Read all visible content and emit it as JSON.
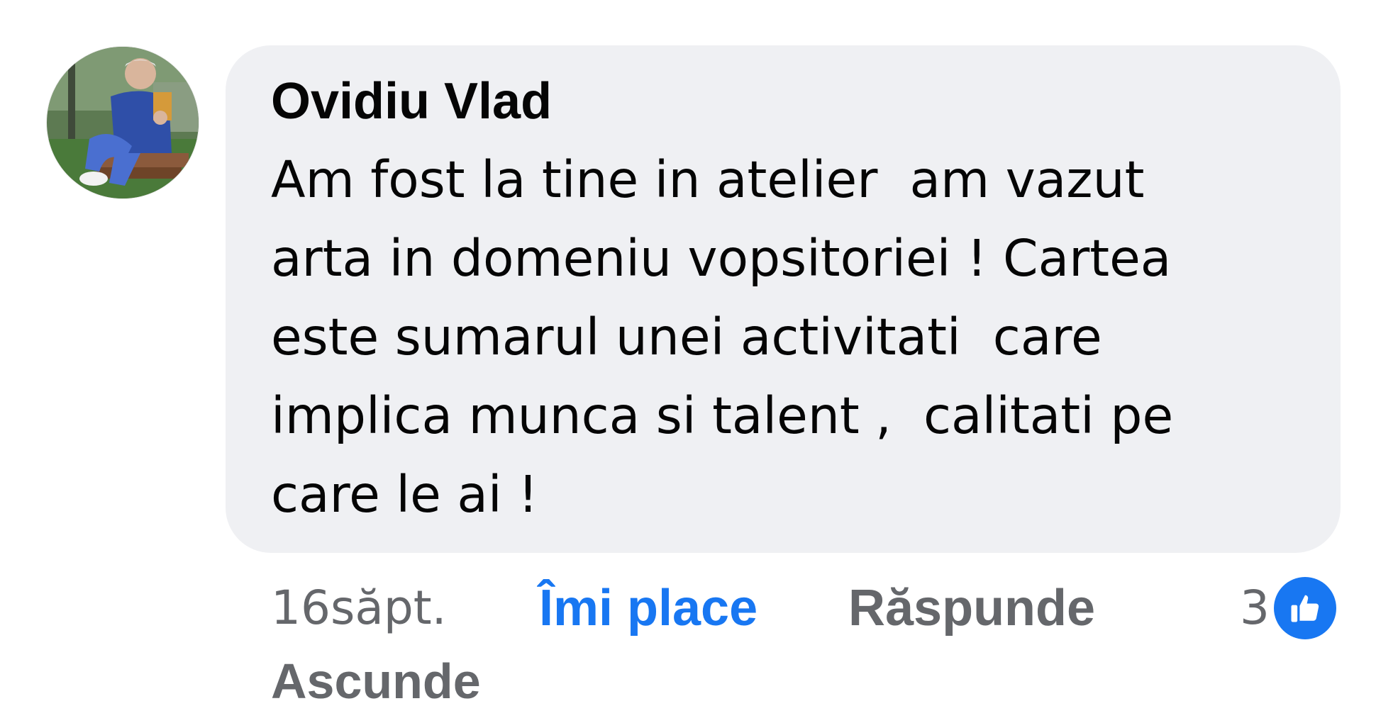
{
  "comment": {
    "author": "Ovidiu Vlad",
    "avatar_icon": "user-avatar",
    "text": "Am fost la tine in atelier  am vazut\narta in domeniu vopsitoriei ! Cartea\neste sumarul unei activitati  care\nimplica munca si talent ,  calitati pe\ncare le ai !",
    "timestamp": "16săpt.",
    "actions": {
      "like": "Îmi place",
      "reply": "Răspunde",
      "hide": "Ascunde"
    },
    "reactions": {
      "count": "3",
      "icon": "thumbs-up-icon"
    }
  },
  "colors": {
    "bubble": "#eff0f3",
    "text": "#050505",
    "secondary": "#65676b",
    "accent": "#1877f2"
  }
}
